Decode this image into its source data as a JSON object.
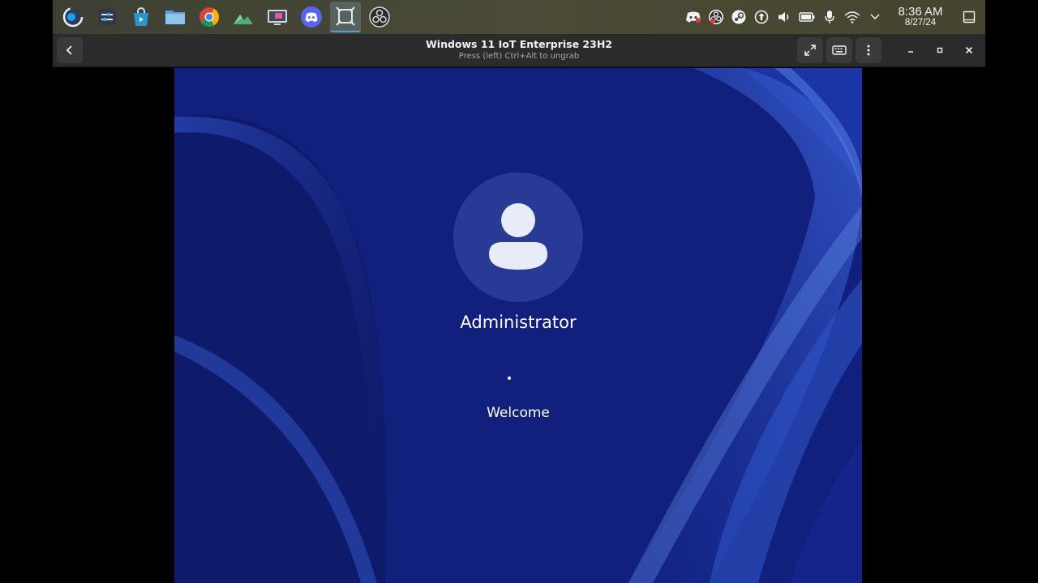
{
  "taskbar": {
    "apps": [
      {
        "name": "steam-menu-icon"
      },
      {
        "name": "system-settings-icon"
      },
      {
        "name": "discover-store-icon"
      },
      {
        "name": "file-manager-icon"
      },
      {
        "name": "chrome-icon"
      },
      {
        "name": "image-viewer-icon"
      },
      {
        "name": "remote-desktop-icon"
      },
      {
        "name": "discord-icon"
      },
      {
        "name": "virt-viewer-icon"
      },
      {
        "name": "obs-icon"
      }
    ],
    "tray": [
      "discord-tray-icon",
      "obs-tray-icon",
      "steam-tray-icon",
      "updates-icon",
      "volume-icon",
      "battery-icon",
      "microphone-icon",
      "wifi-icon",
      "tray-expand-icon"
    ],
    "clock": {
      "time": "8:36 AM",
      "date": "8/27/24"
    }
  },
  "viewer": {
    "title": "Windows 11 IoT Enterprise 23H2",
    "subtitle": "Press (left) Ctrl+Alt to ungrab"
  },
  "vm": {
    "username": "Administrator",
    "status": "Welcome"
  },
  "colors": {
    "taskbar": "#45452f",
    "headerbar": "#2b2b2b",
    "wallpaper": "#13207a",
    "accent": "#4aa3df"
  }
}
